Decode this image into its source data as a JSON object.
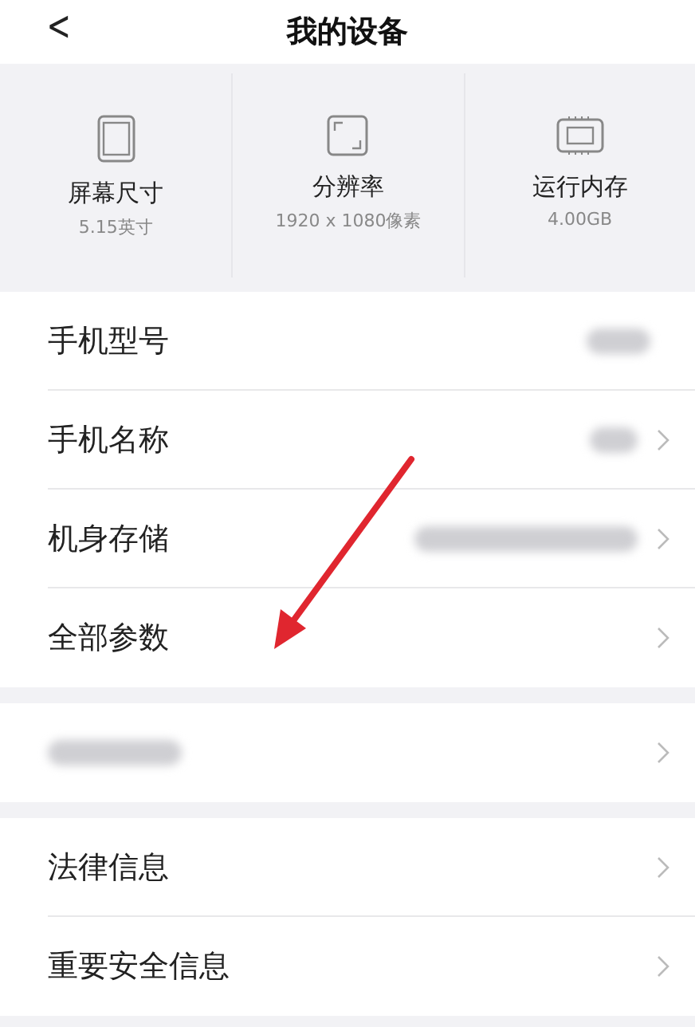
{
  "header": {
    "back": "<",
    "title": "我的设备"
  },
  "specs": [
    {
      "kind": "screen",
      "label": "屏幕尺寸",
      "value": "5.15英寸"
    },
    {
      "kind": "resolution",
      "label": "分辨率",
      "value": "1920 x 1080像素"
    },
    {
      "kind": "memory",
      "label": "运行内存",
      "value": "4.00GB"
    }
  ],
  "groups": [
    [
      {
        "label": "手机型号",
        "redacted_value": true,
        "chevron": false
      },
      {
        "label": "手机名称",
        "redacted_value": true,
        "chevron": true
      },
      {
        "label": "机身存储",
        "redacted_value": true,
        "chevron": true
      },
      {
        "label": "全部参数",
        "redacted_value": false,
        "chevron": true
      }
    ],
    [
      {
        "redacted_label": true,
        "redacted_value": false,
        "chevron": true
      }
    ],
    [
      {
        "label": "法律信息",
        "redacted_value": false,
        "chevron": true
      },
      {
        "label": "重要安全信息",
        "redacted_value": false,
        "chevron": true
      }
    ]
  ],
  "annotation": {
    "kind": "arrow",
    "color": "#e0262f"
  }
}
